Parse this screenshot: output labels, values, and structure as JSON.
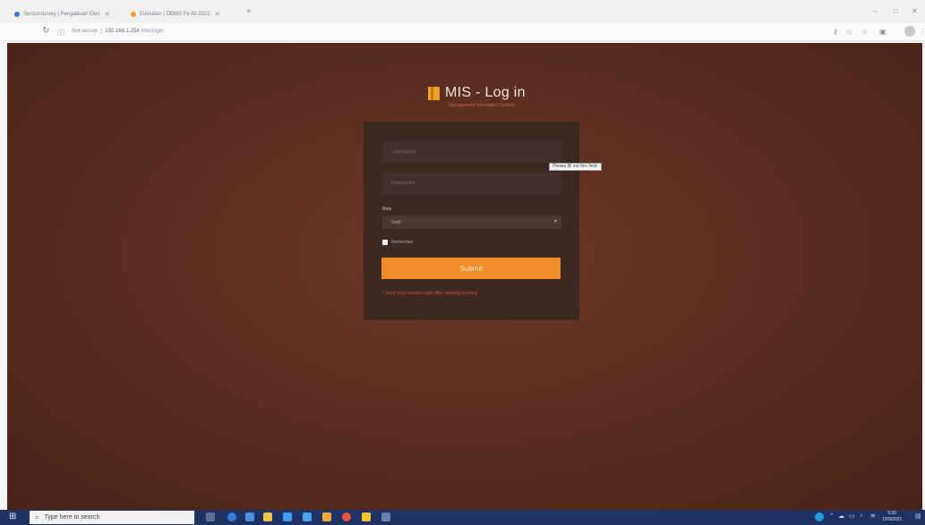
{
  "browser": {
    "tabs": [
      {
        "label": "Sensorsurvey | Pengaduan Elec",
        "favicon_color": "#3a7bd5"
      },
      {
        "label": "Evolution | DBMS Fe All 2021",
        "favicon_color": "#f0a12a"
      }
    ],
    "address": {
      "security_text": "Not secure",
      "ip": "192.168.1.254",
      "path": "/mis/login"
    }
  },
  "page": {
    "title": "MIS - Log in",
    "subtitle": "Management Information System",
    "username_placeholder": "Username",
    "password_placeholder": "Password",
    "role_label": "Role",
    "role_value": "Staff",
    "remember_label": "Remember",
    "login_button": "Submit",
    "warning_text": "* Sorry your session login after opening warning",
    "tooltip_text": "Please fill out this field.",
    "accent_color": "#f08c2a",
    "warning_color": "#e0542e"
  },
  "taskbar": {
    "search_placeholder": "Type here to search",
    "clock_time": "9:30",
    "clock_date": "10/9/2021"
  }
}
